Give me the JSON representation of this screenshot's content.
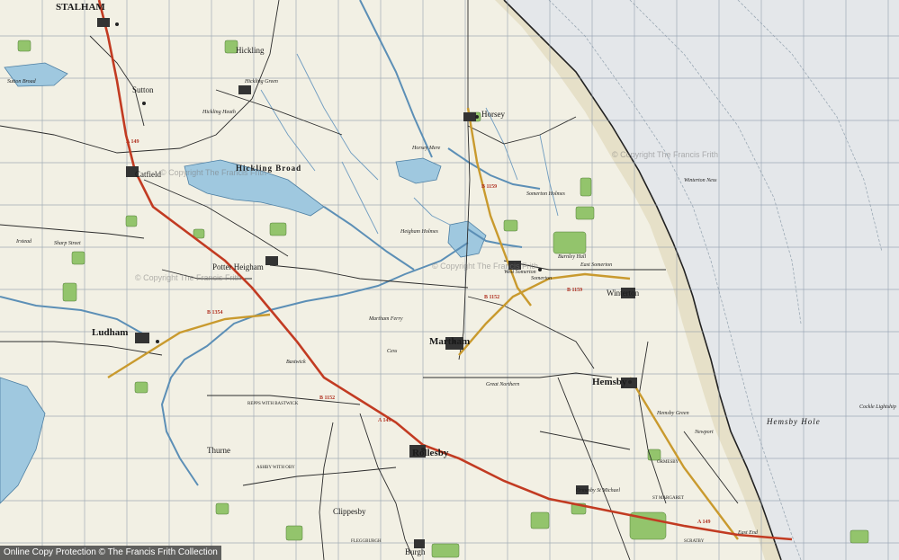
{
  "map": {
    "places": {
      "stalham": "STALHAM",
      "hickling": "Hickling",
      "sutton": "Sutton",
      "sutton_broad": "Sutton Broad",
      "hickling_green": "Hickling Green",
      "hickling_heath": "Hickling Heath",
      "hickling_broad": "Hickling Broad",
      "catfield": "Catfield",
      "potter_heigham": "Potter Heigham",
      "ludham": "Ludham",
      "horsey": "Horsey",
      "horsey_mere": "Horsey Mere",
      "winterton": "Winterton",
      "winterton_ness": "Winterton Ness",
      "east_somerton": "East Somerton",
      "west_somerton": "West Somerton",
      "somerton_holmes": "Somerton Holmes",
      "martham": "Martham",
      "hemsby": "Hemsby",
      "hemsby_hole": "Hemsby Hole",
      "rollesby": "Rollesby",
      "ormesby_st_michael": "Ormesby St Michael",
      "thurne": "Thurne",
      "ashby_with_oby": "ASHBY WITH OBY",
      "repps_with_bastwick": "REPPS WITH BASTWICK",
      "clippesby": "Clippesby",
      "fleggburgh": "FLEGGBURGH",
      "burgh": "Burgh",
      "scratby": "SCRATBY",
      "east_end": "East End",
      "st_margaret": "ST MARGARET",
      "ormesby": "ORMESBY",
      "somerton": "Somerton",
      "cockle_lightship": "Cockle Lightship",
      "newport": "Newport",
      "heigham_holmes": "Heigham Holmes",
      "sharp_street": "Sharp Street",
      "irstead": "Irstead",
      "martham_ferry": "Martham Ferry",
      "cess": "Cess",
      "great_northern": "Great Northern",
      "hemsby_green": "Hemsby Green",
      "somerton_hall": "Burnley Hall",
      "bastwick": "Bastwick"
    },
    "roads": {
      "a149_north": "A 149",
      "b1354": "B 1354",
      "a149_south": "A 149",
      "b1152": "B 1152",
      "b1159": "B 1159",
      "b1152_martham": "B 1152",
      "a149_east": "A 149",
      "b1159_horsey": "B 1159"
    },
    "watermarks": {
      "top": "© Copyright The Francis Frith",
      "mid_left": "© Copyright The Francis Frith",
      "mid_center": "© Copyright The Francis Frith",
      "right": "© Copyright The Francis Frith"
    }
  },
  "colors": {
    "land": "#f0efe6",
    "sea": "#e8eaec",
    "water": "#9ec7de",
    "woodland": "#8fc36a",
    "road_main": "#c23b22",
    "road_secondary": "#c99a2e",
    "minor_road": "#333333",
    "grid": "#7a8a9a",
    "coast": "#333333"
  },
  "footer": {
    "copyright": "Online Copy Protection  ©  The Francis Frith Collection"
  }
}
